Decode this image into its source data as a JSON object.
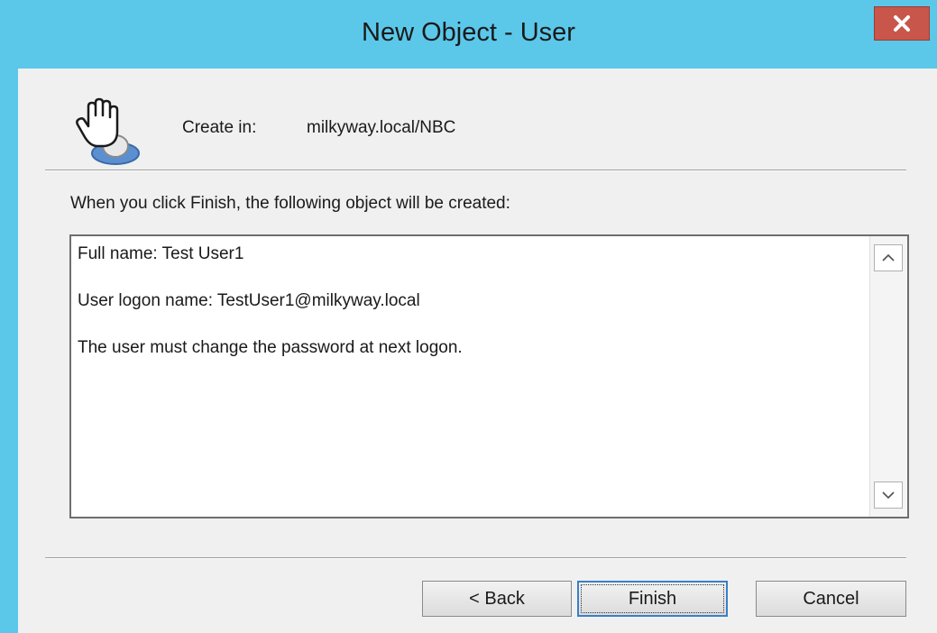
{
  "window": {
    "title": "New Object - User",
    "close_label": "×",
    "titlebar_color": "#5bc8ea",
    "close_color": "#c8564a"
  },
  "header": {
    "icon": "user-icon",
    "create_in_label": "Create in:",
    "create_in_path": "milkyway.local/NBC"
  },
  "info_text": "When you click Finish, the following object will be created:",
  "summary": {
    "lines": [
      "Full name: Test User1",
      "User logon name: TestUser1@milkyway.local",
      "The user must change the password at next logon."
    ]
  },
  "buttons": {
    "back": "< Back",
    "finish": "Finish",
    "cancel": "Cancel"
  }
}
